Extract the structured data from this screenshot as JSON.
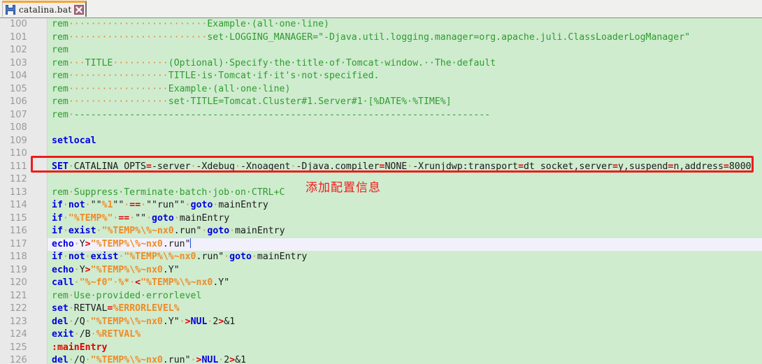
{
  "tab": {
    "title": "catalina.bat",
    "save_icon": "floppy-disk-save-icon",
    "close_icon": "close-x-icon"
  },
  "editor": {
    "first_line_number": 100,
    "current_line_number": 117,
    "background_color": "#cfeccf",
    "gutter_color": "#e9e9e9",
    "current_line_color": "#f2f1fb"
  },
  "annotation": {
    "text": "添加配置信息",
    "color": "#f01c1c",
    "highlight_box_color": "#ee1c1c",
    "highlight_line_number": 111
  },
  "lines": [
    {
      "n": "100",
      "text": "rem                         Example (all one line)"
    },
    {
      "n": "101",
      "text": "rem                         set LOGGING_MANAGER=\"-Djava.util.logging.manager=org.apache.juli.ClassLoaderLogManager\""
    },
    {
      "n": "102",
      "text": "rem"
    },
    {
      "n": "103",
      "text": "rem   TITLE           (Optional) Specify the title of Tomcat window.  The default"
    },
    {
      "n": "104",
      "text": "rem                   TITLE is Tomcat if it's not specified."
    },
    {
      "n": "105",
      "text": "rem                   Example (all one line)"
    },
    {
      "n": "106",
      "text": "rem                   set TITLE=Tomcat.Cluster#1.Server#1 [%DATE% %TIME%]"
    },
    {
      "n": "107",
      "text": "rem ---------------------------------------------------------------------------"
    },
    {
      "n": "108",
      "text": ""
    },
    {
      "n": "109",
      "text": "setlocal"
    },
    {
      "n": "110",
      "text": ""
    },
    {
      "n": "111",
      "text": "SET CATALINA_OPTS=-server -Xdebug -Xnoagent -Djava.compiler=NONE -Xrunjdwp:transport=dt_socket,server=y,suspend=n,address=8000"
    },
    {
      "n": "112",
      "text": ""
    },
    {
      "n": "113",
      "text": "rem Suppress Terminate batch job on CTRL+C"
    },
    {
      "n": "114",
      "text": "if not \"\"%1\"\" == \"\"run\"\" goto mainEntry"
    },
    {
      "n": "115",
      "text": "if \"%TEMP%\" == \"\" goto mainEntry"
    },
    {
      "n": "116",
      "text": "if exist \"%TEMP%\\%~nx0.run\" goto mainEntry"
    },
    {
      "n": "117",
      "text": "echo Y>\"%TEMP%\\%~nx0.run\""
    },
    {
      "n": "118",
      "text": "if not exist \"%TEMP%\\%~nx0.run\" goto mainEntry"
    },
    {
      "n": "119",
      "text": "echo Y>\"%TEMP%\\%~nx0.Y\""
    },
    {
      "n": "120",
      "text": "call \"%~f0\" %* <\"%TEMP%\\%~nx0.Y\""
    },
    {
      "n": "121",
      "text": "rem Use provided errorlevel"
    },
    {
      "n": "122",
      "text": "set RETVAL=%ERRORLEVEL%"
    },
    {
      "n": "123",
      "text": "del /Q \"%TEMP%\\%~nx0.Y\" >NUL 2>&1"
    },
    {
      "n": "124",
      "text": "exit /B %RETVAL%"
    },
    {
      "n": "125",
      "text": ":mainEntry"
    },
    {
      "n": "126",
      "text": "del /Q \"%TEMP%\\%~nx0.run\" >NUL 2>&1"
    }
  ]
}
